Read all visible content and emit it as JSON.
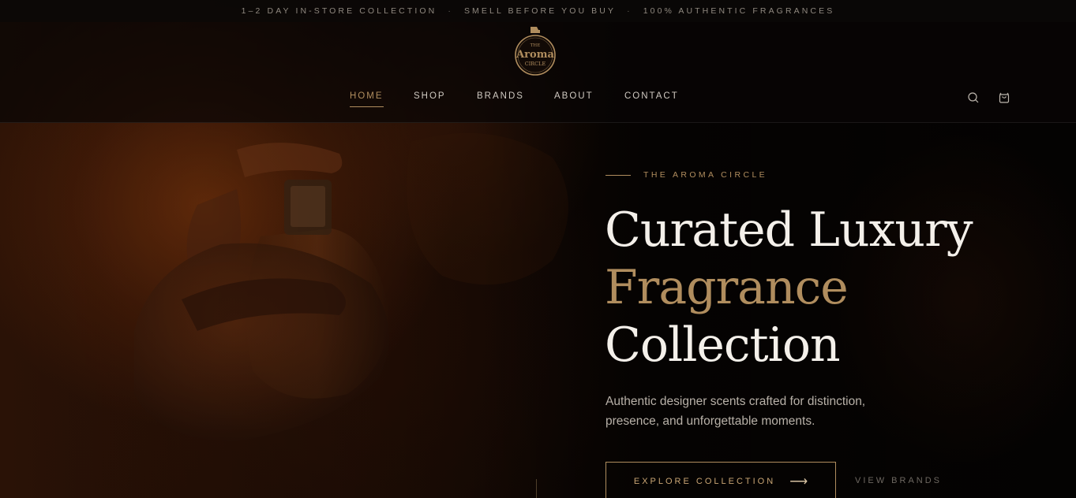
{
  "announcement": {
    "items": [
      "1–2 DAY IN-STORE COLLECTION",
      "SMELL BEFORE YOU BUY",
      "100% AUTHENTIC FRAGRANCES"
    ],
    "separator": "·"
  },
  "logo": {
    "top": "THE",
    "main": "Aroma",
    "bottom": "CIRCLE"
  },
  "nav": {
    "items": [
      {
        "label": "HOME",
        "active": true
      },
      {
        "label": "SHOP"
      },
      {
        "label": "BRANDS"
      },
      {
        "label": "ABOUT"
      },
      {
        "label": "CONTACT"
      }
    ]
  },
  "header_icons": [
    "search-icon",
    "cart-icon"
  ],
  "hero": {
    "eyebrow": "THE AROMA CIRCLE",
    "headline_line1": "Curated Luxury",
    "headline_line2": "Fragrance",
    "headline_line3": "Collection",
    "subtext": "Authentic designer scents crafted for distinction, presence, and unforgettable moments.",
    "primary_cta": "EXPLORE COLLECTION",
    "primary_cta_arrow": "⟶",
    "secondary_cta": "VIEW BRANDS"
  },
  "colors": {
    "accent_gold": "#b08d5e",
    "background": "#070504",
    "text_light": "#f4f0ea"
  }
}
